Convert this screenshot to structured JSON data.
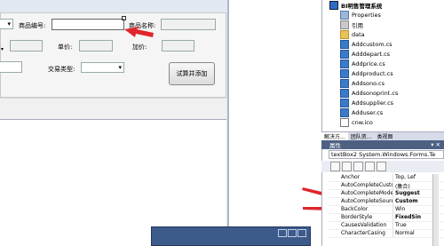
{
  "form": {
    "product_code_label": "商品编号:",
    "product_name_label": "商品名称:",
    "unit_price_label": "单价:",
    "price_label": "加价:",
    "trade_type_label": "交易类型:",
    "add_button_label": "试算并添加",
    "product_code_value": "",
    "product_name_value": ""
  },
  "solution_explorer": {
    "project_name": "BI明售管理系统",
    "items": [
      {
        "label": "Properties",
        "icon": "properties-icon"
      },
      {
        "label": "引用",
        "icon": "references-icon"
      },
      {
        "label": "data",
        "icon": "folder-icon"
      },
      {
        "label": "Addcustom.cs",
        "icon": "cs-file-icon"
      },
      {
        "label": "Adddepart.cs",
        "icon": "cs-file-icon"
      },
      {
        "label": "Addprice.cs",
        "icon": "cs-file-icon"
      },
      {
        "label": "Addproduct.cs",
        "icon": "cs-file-icon"
      },
      {
        "label": "Addsono.cs",
        "icon": "cs-file-icon"
      },
      {
        "label": "Addsonoprint.cs",
        "icon": "cs-file-icon"
      },
      {
        "label": "Addsupplier.cs",
        "icon": "cs-file-icon"
      },
      {
        "label": "Adduser.cs",
        "icon": "cs-file-icon"
      },
      {
        "label": "cnw.ico",
        "icon": "ico-file-icon"
      }
    ],
    "tabs": [
      "解决方...",
      "团队资...",
      "类视图"
    ]
  },
  "properties": {
    "title": "属性",
    "object": "textBox2 System.Windows.Forms.Te",
    "rows": [
      {
        "name": "Anchor",
        "value": "Top, Lef",
        "bold": false
      },
      {
        "name": "AutoCompleteCustomSo",
        "value": "(集合)",
        "bold": false
      },
      {
        "name": "AutoCompleteMode",
        "value": "Suggest",
        "bold": true
      },
      {
        "name": "AutoCompleteSource",
        "value": "Custom",
        "bold": true
      },
      {
        "name": "BackColor",
        "value": "Win",
        "bold": false
      },
      {
        "name": "BorderStyle",
        "value": "FixedSin",
        "bold": true
      },
      {
        "name": "CausesValidation",
        "value": "True",
        "bold": false
      },
      {
        "name": "CharacterCasing",
        "value": "Normal",
        "bold": false
      }
    ]
  },
  "colors": {
    "accent_arrow": "#e0262b",
    "properties_titlebar": "#4d6082"
  }
}
